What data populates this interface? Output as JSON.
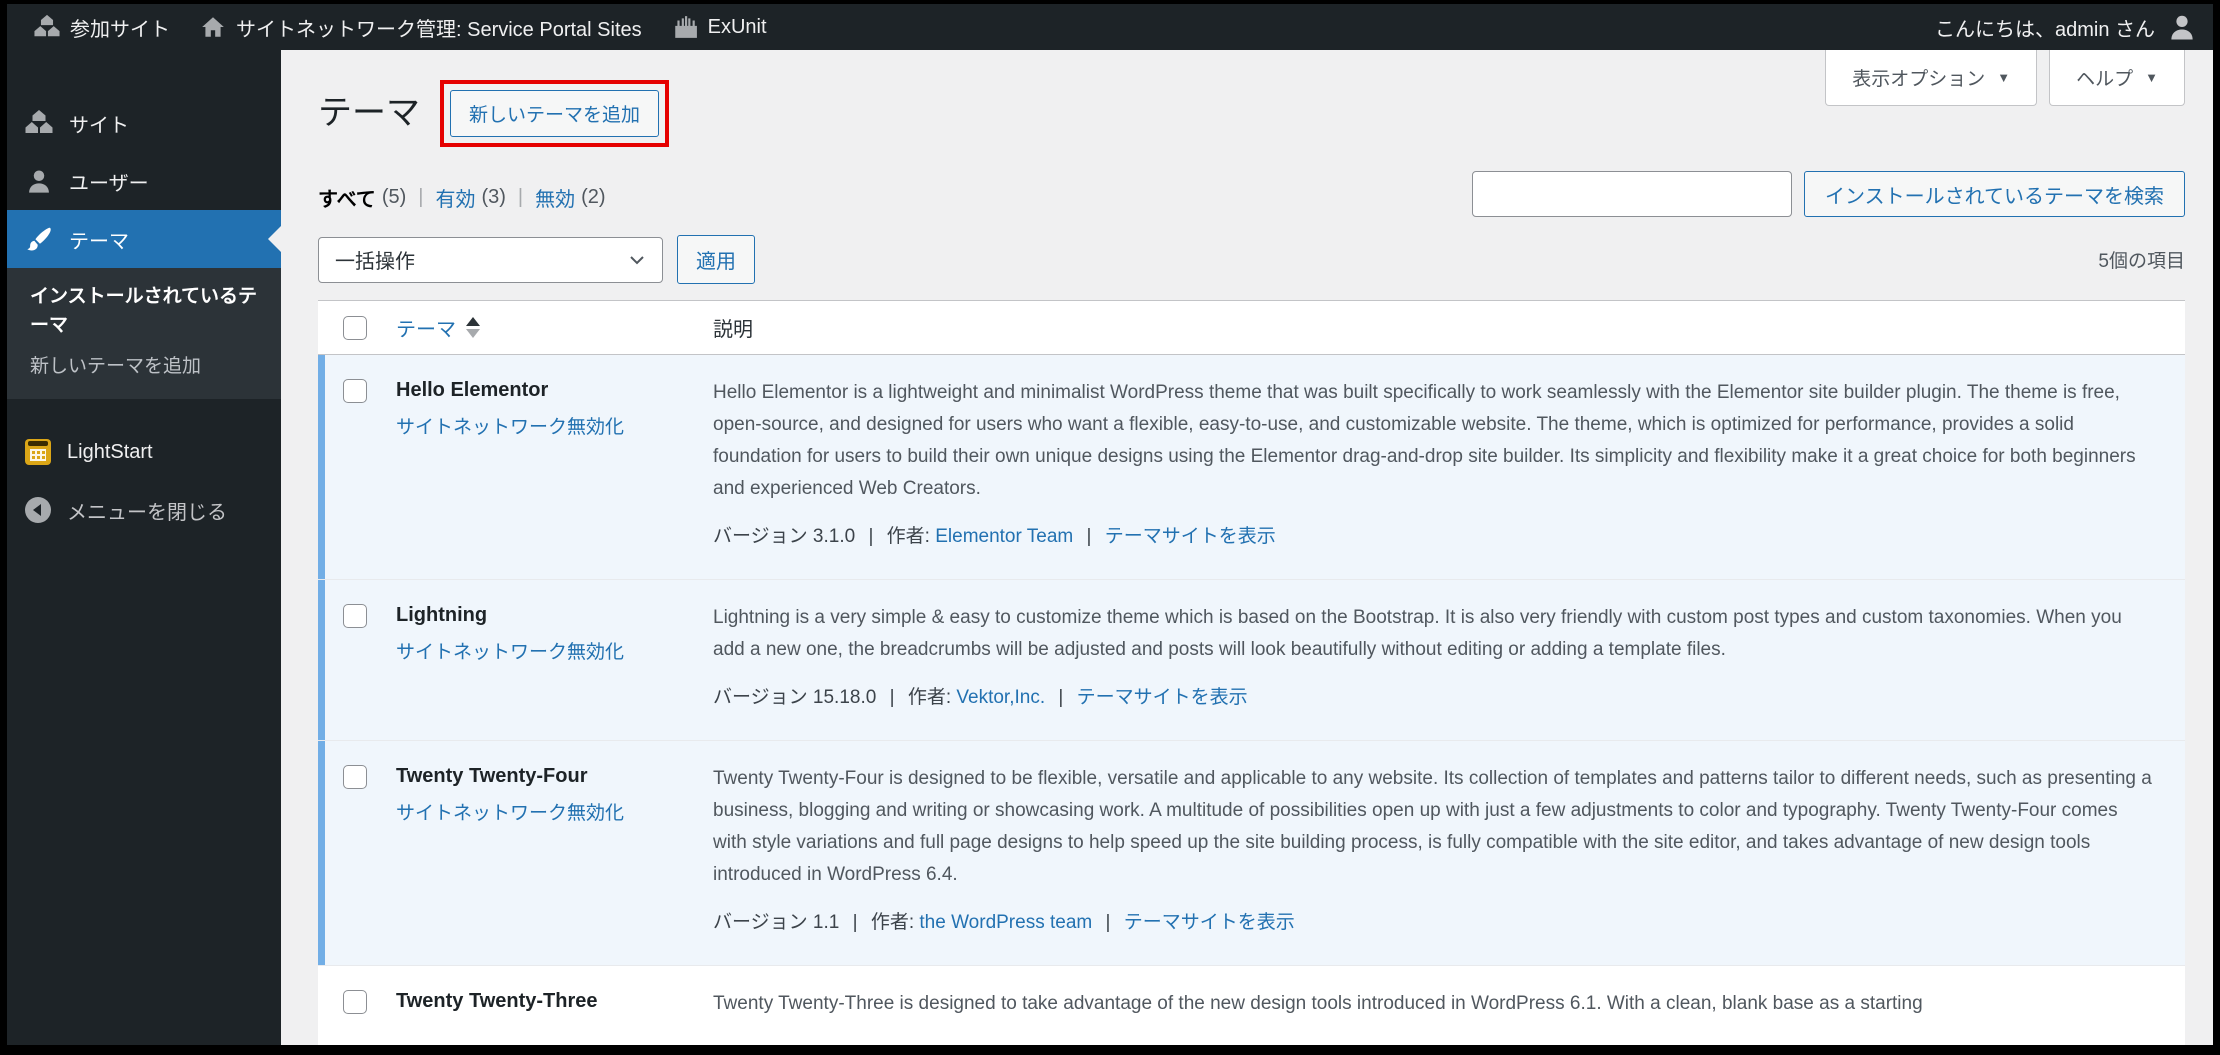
{
  "admin_bar": {
    "my_sites": "参加サイト",
    "network_admin": "サイトネットワーク管理: Service Portal Sites",
    "exunit": "ExUnit",
    "greeting": "こんにちは、admin さん"
  },
  "sidebar": {
    "sites": "サイト",
    "users": "ユーザー",
    "themes": "テーマ",
    "submenu_installed": "インストールされているテーマ",
    "submenu_add_new": "新しいテーマを追加",
    "lightstart": "LightStart",
    "collapse": "メニューを閉じる"
  },
  "page": {
    "title": "テーマ",
    "add_new_button": "新しいテーマを追加"
  },
  "screen_meta": {
    "screen_options": "表示オプション",
    "help": "ヘルプ",
    "caret": "▼"
  },
  "filters": {
    "all": "すべて",
    "all_count": "(5)",
    "enabled": "有効",
    "enabled_count": "(3)",
    "disabled": "無効",
    "disabled_count": "(2)",
    "separator": "|"
  },
  "search": {
    "value": "",
    "button": "インストールされているテーマを検索"
  },
  "toolbar": {
    "bulk_action": "一括操作",
    "apply": "適用",
    "items_count": "5個の項目"
  },
  "table": {
    "col_theme": "テーマ",
    "col_description": "説明"
  },
  "meta_labels": {
    "version": "バージョン",
    "author": "作者:",
    "view_site": "テーマサイトを表示",
    "separator": "|"
  },
  "themes": [
    {
      "name": "Hello Elementor",
      "action": "サイトネットワーク無効化",
      "description": "Hello Elementor is a lightweight and minimalist WordPress theme that was built specifically to work seamlessly with the Elementor site builder plugin. The theme is free, open-source, and designed for users who want a flexible, easy-to-use, and customizable website. The theme, which is optimized for performance, provides a solid foundation for users to build their own unique designs using the Elementor drag-and-drop site builder. Its simplicity and flexibility make it a great choice for both beginners and experienced Web Creators.",
      "version": "3.1.0",
      "author": "Elementor Team",
      "network_enabled": true
    },
    {
      "name": "Lightning",
      "action": "サイトネットワーク無効化",
      "description": "Lightning is a very simple & easy to customize theme which is based on the Bootstrap. It is also very friendly with custom post types and custom taxonomies. When you add a new one, the breadcrumbs will be adjusted and posts will look beautifully without editing or adding a template files.",
      "version": "15.18.0",
      "author": "Vektor,Inc.",
      "network_enabled": true
    },
    {
      "name": "Twenty Twenty-Four",
      "action": "サイトネットワーク無効化",
      "description": "Twenty Twenty-Four is designed to be flexible, versatile and applicable to any website. Its collection of templates and patterns tailor to different needs, such as presenting a business, blogging and writing or showcasing work. A multitude of possibilities open up with just a few adjustments to color and typography. Twenty Twenty-Four comes with style variations and full page designs to help speed up the site building process, is fully compatible with the site editor, and takes advantage of new design tools introduced in WordPress 6.4.",
      "version": "1.1",
      "author": "the WordPress team",
      "network_enabled": true
    },
    {
      "name": "Twenty Twenty-Three",
      "description": "Twenty Twenty-Three is designed to take advantage of the new design tools introduced in WordPress 6.1. With a clean, blank base as a starting",
      "network_enabled": false
    }
  ],
  "colors": {
    "accent_blue": "#2271b1",
    "annotation_red": "#e50000",
    "active_row_bg": "#f0f6fc",
    "active_row_stripe": "#72aee6",
    "admin_dark": "#1d2327",
    "submenu_bg": "#2c3338"
  }
}
